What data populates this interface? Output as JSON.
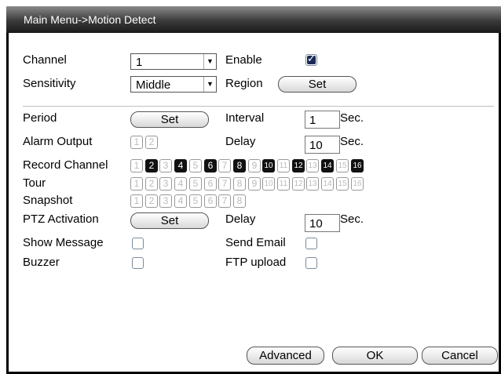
{
  "window": {
    "title": "Main Menu->Motion Detect"
  },
  "form": {
    "channel": {
      "label": "Channel",
      "value": "1"
    },
    "enable": {
      "label": "Enable",
      "checked": true
    },
    "sensitivity": {
      "label": "Sensitivity",
      "value": "Middle"
    },
    "region": {
      "label": "Region",
      "button": "Set"
    },
    "period": {
      "label": "Period",
      "button": "Set"
    },
    "interval": {
      "label": "Interval",
      "value": "1",
      "unit": "Sec."
    },
    "alarm_output": {
      "label": "Alarm Output",
      "channels": [
        "1",
        "2"
      ],
      "selected": []
    },
    "delay1": {
      "label": "Delay",
      "value": "10",
      "unit": "Sec."
    },
    "record_channel": {
      "label": "Record Channel",
      "channels": [
        "1",
        "2",
        "3",
        "4",
        "5",
        "6",
        "7",
        "8",
        "9",
        "10",
        "11",
        "12",
        "13",
        "14",
        "15",
        "16"
      ],
      "selected": [
        "2",
        "4",
        "6",
        "8",
        "10",
        "12",
        "14",
        "16"
      ]
    },
    "tour": {
      "label": "Tour",
      "channels": [
        "1",
        "2",
        "3",
        "4",
        "5",
        "6",
        "7",
        "8",
        "9",
        "10",
        "11",
        "12",
        "13",
        "14",
        "15",
        "16"
      ],
      "selected": []
    },
    "snapshot": {
      "label": "Snapshot",
      "channels": [
        "1",
        "2",
        "3",
        "4",
        "5",
        "6",
        "7",
        "8"
      ],
      "selected": []
    },
    "ptz_activation": {
      "label": "PTZ Activation",
      "button": "Set"
    },
    "delay2": {
      "label": "Delay",
      "value": "10",
      "unit": "Sec."
    },
    "show_message": {
      "label": "Show Message",
      "checked": false
    },
    "send_email": {
      "label": "Send Email",
      "checked": false
    },
    "buzzer": {
      "label": "Buzzer",
      "checked": false
    },
    "ftp_upload": {
      "label": "FTP upload",
      "checked": false
    }
  },
  "footer": {
    "advanced": "Advanced",
    "ok": "OK",
    "cancel": "Cancel"
  }
}
